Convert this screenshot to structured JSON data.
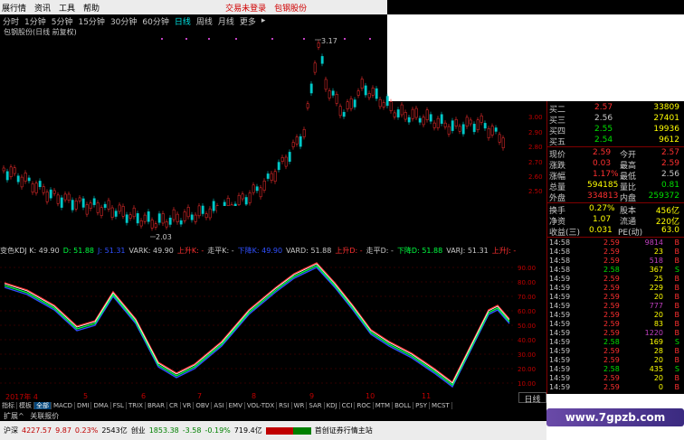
{
  "menubar": {
    "items": [
      "展行情",
      "资讯",
      "工具",
      "帮助"
    ],
    "status_text": "交易未登录",
    "stock_name": "包钢股份"
  },
  "periodbar": {
    "items": [
      "分时",
      "1分钟",
      "5分钟",
      "15分钟",
      "30分钟",
      "60分钟",
      "日线",
      "周线",
      "月线",
      "更多"
    ],
    "active": "日线",
    "more_arrow": "▸"
  },
  "title_line": "包钢股份(日线 前复权)",
  "main_chart": {
    "high_label": "3.17",
    "low_label": "2.03"
  },
  "price_axis": [
    "3.00",
    "2.90",
    "2.80",
    "2.70",
    "2.60",
    "2.50"
  ],
  "quotes": {
    "bids": [
      {
        "label": "买二",
        "price": "2.57",
        "vol": "33809"
      },
      {
        "label": "买三",
        "price": "2.56",
        "vol": "27401"
      },
      {
        "label": "买四",
        "price": "2.55",
        "vol": "19936"
      },
      {
        "label": "买五",
        "price": "2.54",
        "vol": "9612"
      }
    ],
    "stats": [
      {
        "l1": "现价",
        "v1": "2.59",
        "l2": "今开",
        "v2": "2.57"
      },
      {
        "l1": "涨跌",
        "v1": "0.03",
        "l2": "最高",
        "v2": "2.59"
      },
      {
        "l1": "涨幅",
        "v1": "1.17%",
        "l2": "最低",
        "v2": "2.56"
      },
      {
        "l1": "总量",
        "v1": "594185",
        "l2": "量比",
        "v2": "0.81"
      },
      {
        "l1": "外盘",
        "v1": "334813",
        "l2": "内盘",
        "v2": "259372"
      },
      {
        "l1": "换手",
        "v1": "0.27%",
        "l2": "股本",
        "v2": "456亿"
      },
      {
        "l1": "净资",
        "v1": "1.07",
        "l2": "流通",
        "v2": "220亿"
      },
      {
        "l1": "收益(三)",
        "v1": "0.031",
        "l2": "PE(动)",
        "v2": "63.0"
      }
    ],
    "ticks": [
      {
        "time": "14:58",
        "price": "2.59",
        "vol": "9814",
        "bs": "B"
      },
      {
        "time": "14:58",
        "price": "2.59",
        "vol": "23",
        "bs": "B"
      },
      {
        "time": "14:58",
        "price": "2.59",
        "vol": "518",
        "bs": "B"
      },
      {
        "time": "14:58",
        "price": "2.58",
        "vol": "367",
        "bs": "S"
      },
      {
        "time": "14:59",
        "price": "2.59",
        "vol": "25",
        "bs": "B"
      },
      {
        "time": "14:59",
        "price": "2.59",
        "vol": "229",
        "bs": "B"
      },
      {
        "time": "14:59",
        "price": "2.59",
        "vol": "20",
        "bs": "B"
      },
      {
        "time": "14:59",
        "price": "2.59",
        "vol": "777",
        "bs": "B"
      },
      {
        "time": "14:59",
        "price": "2.59",
        "vol": "20",
        "bs": "B"
      },
      {
        "time": "14:59",
        "price": "2.59",
        "vol": "83",
        "bs": "B"
      },
      {
        "time": "14:59",
        "price": "2.59",
        "vol": "1220",
        "bs": "B"
      },
      {
        "time": "14:59",
        "price": "2.58",
        "vol": "169",
        "bs": "S"
      },
      {
        "time": "14:59",
        "price": "2.59",
        "vol": "28",
        "bs": "B"
      },
      {
        "time": "14:59",
        "price": "2.59",
        "vol": "20",
        "bs": "B"
      },
      {
        "time": "14:59",
        "price": "2.58",
        "vol": "435",
        "bs": "S"
      },
      {
        "time": "14:59",
        "price": "2.59",
        "vol": "20",
        "bs": "B"
      },
      {
        "time": "14:59",
        "price": "2.59",
        "vol": "0",
        "bs": "B"
      }
    ]
  },
  "kdj_header": [
    {
      "text": "变色KDJ K: 49.90",
      "color": "#c8c8c8"
    },
    {
      "text": "D: 51.88",
      "color": "#00ff40"
    },
    {
      "text": "J: 51.31",
      "color": "#3050ff"
    },
    {
      "text": "VARK: 49.90",
      "color": "#c8c8c8"
    },
    {
      "text": "上升K: -",
      "color": "#ff3030"
    },
    {
      "text": "走平K: -",
      "color": "#c8c8c8"
    },
    {
      "text": "下降K: 49.90",
      "color": "#3050ff"
    },
    {
      "text": "VARD: 51.88",
      "color": "#c8c8c8"
    },
    {
      "text": "上升D: -",
      "color": "#ff3030"
    },
    {
      "text": "走平D: -",
      "color": "#c8c8c8"
    },
    {
      "text": "下降D: 51.88",
      "color": "#00ff40"
    },
    {
      "text": "VARJ: 51.31",
      "color": "#c8c8c8"
    },
    {
      "text": "上升J: -",
      "color": "#ff3030"
    },
    {
      "text": "走平J: -",
      "color": "#c8c8c8"
    },
    {
      "text": "下降",
      "color": "#3050ff"
    }
  ],
  "kdj_axis": [
    "90.00",
    "80.00",
    "70.00",
    "60.00",
    "50.00",
    "40.00",
    "30.00",
    "20.00",
    "10.00"
  ],
  "xaxis": [
    "2017年 4",
    "5",
    "6",
    "7",
    "8",
    "9",
    "10",
    "11"
  ],
  "day_button": "日线",
  "tabs": [
    "指标",
    "模板",
    "全部",
    "MACD",
    "DMI",
    "DMA",
    "FSL",
    "TRIX",
    "BRAR",
    "CR",
    "VR",
    "OBV",
    "ASI",
    "EMV",
    "VOL-TDX",
    "RSI",
    "WR",
    "SAR",
    "KDJ",
    "CCI",
    "ROC",
    "MTM",
    "BOLL",
    "PSY",
    "MCST"
  ],
  "tabs_active": "全部",
  "ext_bar": [
    "扩展^",
    "关联报价"
  ],
  "indexbar": {
    "sh_label": "沪深",
    "sh_value": "4227.57",
    "sh_change": "9.87",
    "sh_pct": "0.23%",
    "sh_amount": "2543亿",
    "cy_label": "创业",
    "cy_value": "1853.38",
    "cy_change": "-3.58",
    "cy_pct": "-0.19%",
    "cy_amount": "719.4亿",
    "broker": "首创证券行情主站"
  },
  "watermark": "www.7gpzb.com",
  "colors": {
    "up": "#ff3030",
    "down": "#00c8c8",
    "equal": "#c8c8c8",
    "grid": "#800000",
    "yellow": "#ffff00"
  }
}
